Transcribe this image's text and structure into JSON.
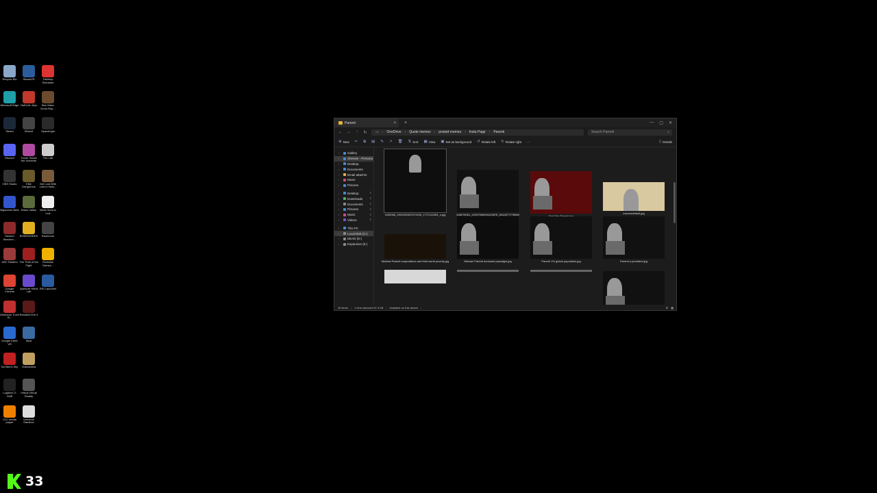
{
  "desktop_icons": [
    {
      "label": "Recycle Bin",
      "color": "#8aa6c9"
    },
    {
      "label": "SteamVR",
      "color": "#2b5d9c"
    },
    {
      "label": "Tabletop Simulator",
      "color": "#d33"
    },
    {
      "label": "Microsoft Edge",
      "color": "#1fa0a8"
    },
    {
      "label": "Half-Life: Alyx",
      "color": "#c2382a"
    },
    {
      "label": "Star Wars: Droid Rep...",
      "color": "#6b4a2e"
    },
    {
      "label": "Steam",
      "color": "#1b2838"
    },
    {
      "label": "Wizard",
      "color": "#444"
    },
    {
      "label": "Spacelogin",
      "color": "#2a2a2a"
    },
    {
      "label": "Discord",
      "color": "#5865f2"
    },
    {
      "label": "Trover Saves the Universe",
      "color": "#b04aa0"
    },
    {
      "label": "The Lab",
      "color": "#ccc"
    },
    {
      "label": "OBS Studio",
      "color": "#333"
    },
    {
      "label": "Elite Dangerous",
      "color": "#6a5a2a"
    },
    {
      "label": "Get Lost With Lola in Halo...",
      "color": "#7a5a3a"
    },
    {
      "label": "Bigscreen Beta",
      "color": "#3355cc"
    },
    {
      "label": "Brass Valley",
      "color": "#5a6a3a"
    },
    {
      "label": "Meta Horizon Link",
      "color": "#eee"
    },
    {
      "label": "Heaven Benchm...",
      "color": "#8a2a2a"
    },
    {
      "label": "BONEWORKS",
      "color": "#e0b020"
    },
    {
      "label": "Raceroom",
      "color": "#444"
    },
    {
      "label": "ARC Raiders",
      "color": "#9a3a3a"
    },
    {
      "label": "The Thrill of the Fight",
      "color": "#a02020"
    },
    {
      "label": "Rockstar Games...",
      "color": "#f0b000"
    },
    {
      "label": "Google Chrome",
      "color": "#dd4433"
    },
    {
      "label": "Aperture Hand Lab",
      "color": "#6a4acc"
    },
    {
      "label": "RSI Launcher",
      "color": "#2a5aa0"
    },
    {
      "label": "American Truck Si...",
      "color": "#c03030"
    },
    {
      "label": "Resident Evil 4",
      "color": "#5a1a1a"
    },
    {
      "label": "",
      "color": "#000"
    },
    {
      "label": "Google Earth VR",
      "color": "#2a6ad0"
    },
    {
      "label": "Myst",
      "color": "#3a6aa0"
    },
    {
      "label": "",
      "color": "#000"
    },
    {
      "label": "No Man's Sky",
      "color": "#c02020"
    },
    {
      "label": "Subnautica",
      "color": "#c0a060"
    },
    {
      "label": "",
      "color": "#000"
    },
    {
      "label": "Logitech G HUB",
      "color": "#222"
    },
    {
      "label": "Virtual Virtual Reality",
      "color": "#555"
    },
    {
      "label": "",
      "color": "#000"
    },
    {
      "label": "VLC media player",
      "color": "#f08000"
    },
    {
      "label": "Universe Sandbox",
      "color": "#ddd"
    }
  ],
  "counter": {
    "value": "33",
    "logo_color": "#53fc18"
  },
  "window": {
    "tab_title": "Parenti",
    "new_tab": "+",
    "breadcrumbs": [
      "OneDrive",
      "Quote memes",
      "posted memes",
      "Insta Page",
      "Parenti"
    ],
    "search_placeholder": "Search Parenti",
    "toolbar": [
      "New",
      "Sort",
      "View",
      "Set as background",
      "Rotate left",
      "Rotate right",
      "Details"
    ],
    "nav_pane": [
      {
        "label": "Gallery",
        "color": "#4a8ad0",
        "sel": false
      },
      {
        "label": "Sherwin - Persona",
        "color": "#4a8ad0",
        "sel": true
      },
      {
        "label": "Desktop",
        "color": "#4a8ad0",
        "sel": false
      },
      {
        "label": "Documents",
        "color": "#4a8ad0",
        "sel": false
      },
      {
        "label": "Email attachm",
        "color": "#e8b23a",
        "sel": false
      },
      {
        "label": "Music",
        "color": "#d04a8a",
        "sel": false
      },
      {
        "label": "Pictures",
        "color": "#4a8ad0",
        "sel": false
      },
      {
        "label": "",
        "color": "",
        "sel": false
      },
      {
        "label": "Desktop",
        "color": "#4a8ad0",
        "sel": false
      },
      {
        "label": "Downloads",
        "color": "#4ab07a",
        "sel": false
      },
      {
        "label": "Documents",
        "color": "#8a8a8a",
        "sel": false
      },
      {
        "label": "Pictures",
        "color": "#4a8ad0",
        "sel": false
      },
      {
        "label": "Music",
        "color": "#d04a8a",
        "sel": false
      },
      {
        "label": "Videos",
        "color": "#8a4ad0",
        "sel": false
      },
      {
        "label": "",
        "color": "",
        "sel": false
      },
      {
        "label": "This PC",
        "color": "#4a8ad0",
        "sel": false
      },
      {
        "label": "Local Disk (C:)",
        "color": "#8a8a8a",
        "sel": true
      },
      {
        "label": "DEAD (D:)",
        "color": "#8a8a8a",
        "sel": false
      },
      {
        "label": "Expansion (E:)",
        "color": "#8a8a8a",
        "sel": false
      }
    ],
    "files": [
      {
        "caption": "1635068_2602089487674408_1772142084_n.jpg",
        "selected": true,
        "style": "dark-quote"
      },
      {
        "caption": "438275061_1915790693412987E_8344077778089 83521_n.jpg",
        "selected": false,
        "style": "speaker-red"
      },
      {
        "caption": "End War Parenti.jpg",
        "selected": false,
        "style": "red-quote"
      },
      {
        "caption": "maxresdefault.jpg",
        "selected": false,
        "style": "gold"
      },
      {
        "caption": "Michael Parenti corporations and third world poverty.jpg",
        "selected": false,
        "style": "wide-dark"
      },
      {
        "caption": "Michael Parenti dominant paradigm.jpg",
        "selected": false,
        "style": "speaker-dark"
      },
      {
        "caption": "Parenti 1% global population.jpg",
        "selected": false,
        "style": "speaker-quote"
      },
      {
        "caption": "Parenti a president.jpg",
        "selected": false,
        "style": "speaker-quote"
      },
      {
        "caption": "",
        "selected": false,
        "style": "wide-light"
      },
      {
        "caption": "",
        "selected": false,
        "style": "partial"
      },
      {
        "caption": "",
        "selected": false,
        "style": "partial"
      },
      {
        "caption": "",
        "selected": false,
        "style": "speaker-quote"
      }
    ],
    "status": {
      "count": "30 items",
      "selected": "1 item selected  94.3 KB",
      "availability": "Available on this device"
    }
  }
}
